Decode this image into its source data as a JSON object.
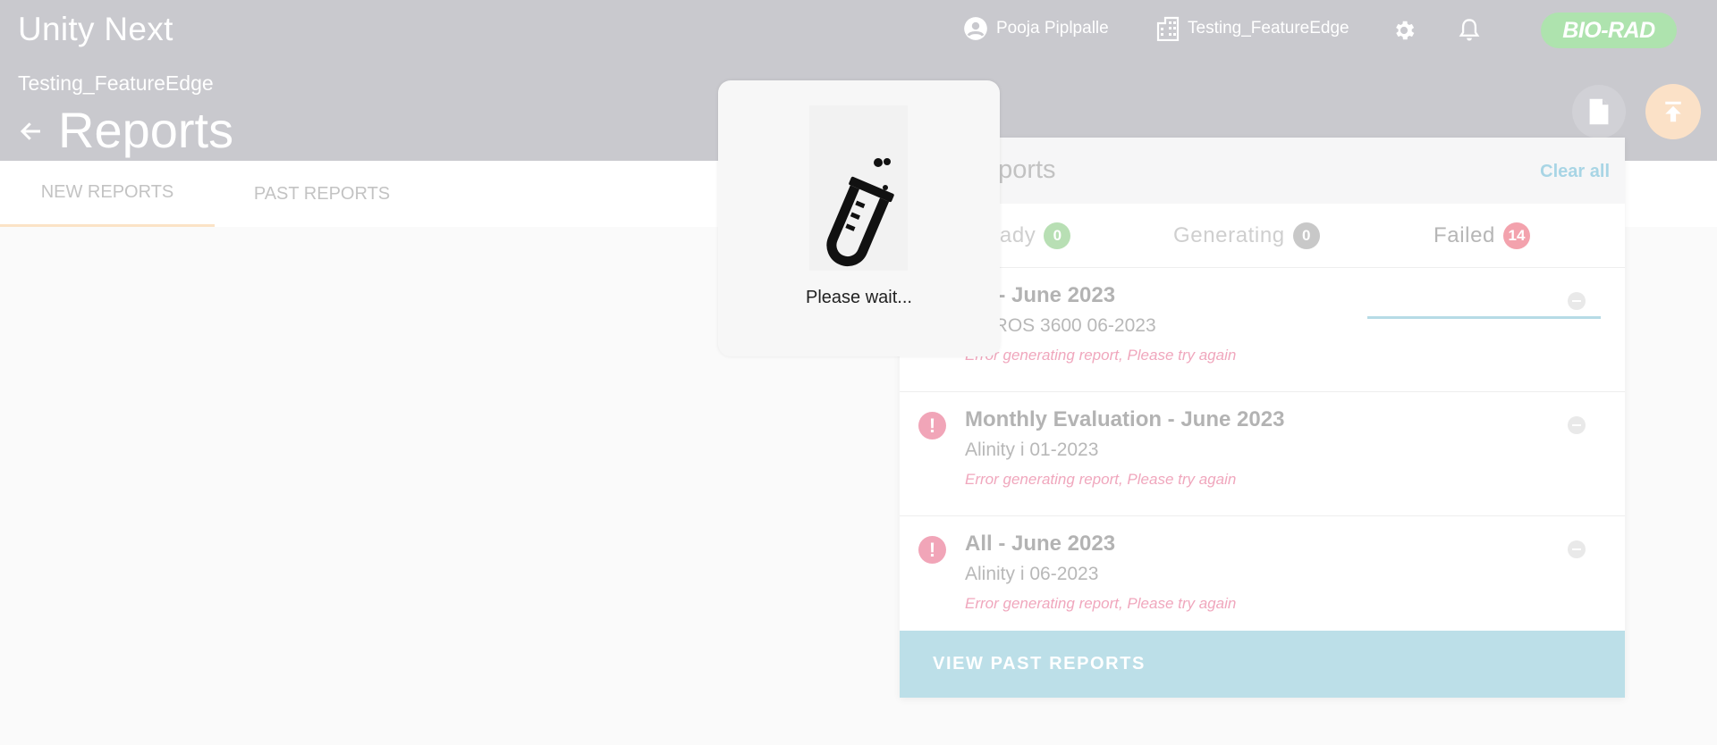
{
  "header": {
    "app_title": "Unity Next",
    "user_name": "Pooja Piplpalle",
    "lab_name": "Testing_FeatureEdge",
    "logo_text": "BIO-RAD",
    "lab_subtitle": "Testing_FeatureEdge",
    "page_title": "Reports",
    "icons": [
      "account-circle-icon",
      "building-icon",
      "gear-icon",
      "bell-icon",
      "back-arrow-icon",
      "document-icon",
      "upload-icon"
    ]
  },
  "tabs": [
    {
      "label": "NEW REPORTS",
      "active": true
    },
    {
      "label": "PAST REPORTS",
      "active": false
    }
  ],
  "reports_panel": {
    "title": "Reports",
    "clear_all": "Clear all",
    "status_tabs": [
      {
        "label": "Ready",
        "count": "0"
      },
      {
        "label": "Generating",
        "count": "0"
      },
      {
        "label": "Failed",
        "count": "14",
        "active": true
      }
    ],
    "items": [
      {
        "name": "All - June 2023",
        "subtitle": "VITROS 3600 06-2023",
        "error": "Error generating report, Please try again"
      },
      {
        "name": "Monthly Evaluation - June 2023",
        "subtitle": "Alinity i 01-2023",
        "error": "Error generating report, Please try again"
      },
      {
        "name": "All - June 2023",
        "subtitle": "Alinity i 06-2023",
        "error": "Error generating report, Please try again"
      }
    ],
    "view_past": "VIEW PAST REPORTS"
  },
  "loading": {
    "text": "Please wait...",
    "icon": "test-tube-icon"
  },
  "colors": {
    "header_bg": "#c9c9ce",
    "accent_orange": "#fbe1c7",
    "logo_green": "#aee3ae",
    "button_blue": "#bcdfe8",
    "error_pink": "#f1a5b8"
  }
}
